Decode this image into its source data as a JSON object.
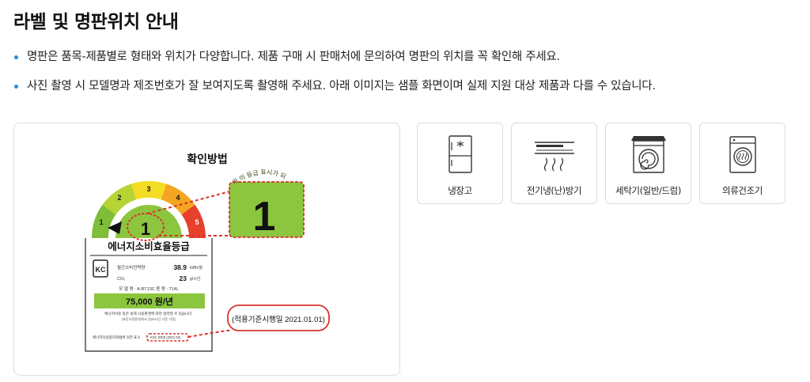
{
  "page": {
    "title": "라벨 및 명판위치 안내",
    "bullets": [
      "명판은 품목-제품별로 형태와 위치가 다양합니다. 제품 구매 시 판매처에 문의하여 명판의 위치를 꼭 확인해 주세요.",
      "사진 촬영 시 모델명과 제조번호가 잘 보여지도록 촬영해 주세요. 아래 이미지는 샘플 화면이며 실제 지원 대상 제품과 다를 수 있습니다."
    ]
  },
  "label_sample": {
    "heading": "확인방법",
    "grade_numbers": [
      "1",
      "2",
      "3",
      "4",
      "5"
    ],
    "current_grade": "1",
    "zoom_grade": "1",
    "zoom_arc_text": "가 이 등급 표시가 되",
    "label_title": "에너지소비효율등급",
    "kc_mark": "KC",
    "rows": [
      {
        "name": "월간소비전력량",
        "value": "38.9",
        "unit": "kWh/월"
      },
      {
        "name": "CO₂",
        "value": "23",
        "unit": "g/시간"
      }
    ],
    "model_line": "모 델 명 : A-BT13C     용 량 : 714L",
    "annual_cost": "75,000 원/년",
    "fine_print_1": "에너지비용 등은 실제 사용환경에 따라 달라질 수 있습니다.",
    "fine_print_2": "(표준사용환경에서 일24시간 기준 가동)",
    "footer_line": "에너지이용합리화법에 의한 표시",
    "footer_code": "KSC 9305 (2021.03)",
    "callout_date": "(적용기준시행일 2021.01.01)",
    "colors": {
      "grade_1": "#7fbe3a",
      "grade_2": "#b6d334",
      "grade_3": "#f3dd24",
      "grade_4": "#f4a622",
      "grade_5": "#e5412c",
      "callout": "#d6342b"
    }
  },
  "products": [
    {
      "label": "냉장고",
      "icon": "refrigerator-icon"
    },
    {
      "label": "전기냉(난)방기",
      "icon": "air-conditioner-icon"
    },
    {
      "label": "세탁기(일반/드럼)",
      "icon": "washing-machine-icon"
    },
    {
      "label": "의류건조기",
      "icon": "clothes-dryer-icon"
    }
  ]
}
